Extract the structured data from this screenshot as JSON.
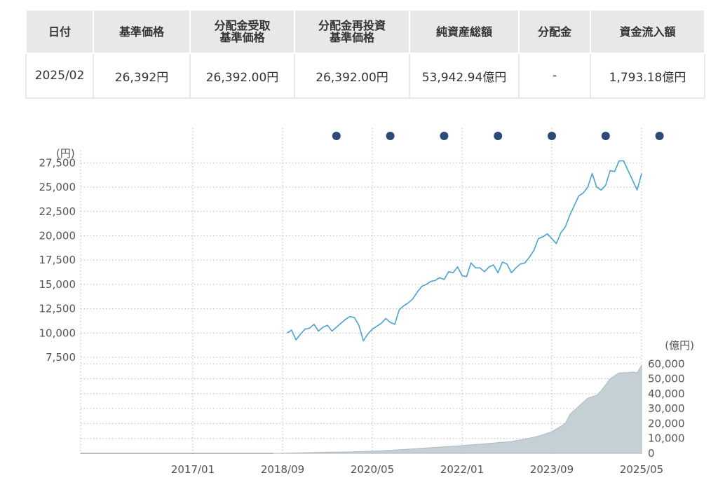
{
  "table": {
    "headers": [
      [
        "日付"
      ],
      [
        "基準価格"
      ],
      [
        "分配金受取",
        "基準価格"
      ],
      [
        "分配金再投資",
        "基準価格"
      ],
      [
        "純資産総額"
      ],
      [
        "分配金"
      ],
      [
        "資金流入額"
      ]
    ],
    "row": [
      "2025/02",
      "26,392円",
      "26,392.00円",
      "26,392.00円",
      "53,942.94億円",
      "-",
      "1,793.18億円"
    ]
  },
  "colors": {
    "price_line": "#4aa3cf",
    "asset_area": "#c5cfd6",
    "marker": "#2b4a76",
    "grid": "#b8b8b8"
  },
  "chart_data": [
    {
      "type": "line",
      "ylabel": "(円)",
      "ylim": [
        7500,
        28750
      ],
      "yticks": [
        "7,500",
        "10,000",
        "12,500",
        "15,000",
        "17,500",
        "20,000",
        "22,500",
        "25,000",
        "27,500"
      ],
      "ytick_values": [
        7500,
        10000,
        12500,
        15000,
        17500,
        20000,
        22500,
        25000,
        27500
      ],
      "xlim": [
        "2014-12",
        "2025-05"
      ],
      "xticks": [
        "2017/01",
        "2018/09",
        "2020/05",
        "2022/01",
        "2023/09",
        "2025/05"
      ],
      "xtick_dates": [
        "2017-01",
        "2018-09",
        "2020-05",
        "2022-01",
        "2023-09",
        "2025-05"
      ],
      "distribution_markers": [
        "2019-09",
        "2020-09",
        "2021-09",
        "2022-09",
        "2023-09",
        "2024-09",
        "2025-09"
      ],
      "series": [
        {
          "x": [
            "2018-10",
            "2018-11",
            "2018-12",
            "2019-01",
            "2019-02",
            "2019-03",
            "2019-04",
            "2019-05",
            "2019-06",
            "2019-07",
            "2019-08",
            "2019-09",
            "2019-10",
            "2019-11",
            "2019-12",
            "2020-01",
            "2020-02",
            "2020-03",
            "2020-04",
            "2020-05",
            "2020-06",
            "2020-07",
            "2020-08",
            "2020-09",
            "2020-10",
            "2020-11",
            "2020-12",
            "2021-01",
            "2021-02",
            "2021-03",
            "2021-04",
            "2021-05",
            "2021-06",
            "2021-07",
            "2021-08",
            "2021-09",
            "2021-10",
            "2021-11",
            "2021-12",
            "2022-01",
            "2022-02",
            "2022-03",
            "2022-04",
            "2022-05",
            "2022-06",
            "2022-07",
            "2022-08",
            "2022-09",
            "2022-10",
            "2022-11",
            "2022-12",
            "2023-01",
            "2023-02",
            "2023-03",
            "2023-04",
            "2023-05",
            "2023-06",
            "2023-07",
            "2023-08",
            "2023-09",
            "2023-10",
            "2023-11",
            "2023-12",
            "2024-01",
            "2024-02",
            "2024-03",
            "2024-04",
            "2024-05",
            "2024-06",
            "2024-07",
            "2024-08",
            "2024-09",
            "2024-10",
            "2024-11",
            "2024-12",
            "2025-01",
            "2025-02",
            "2025-03",
            "2025-04",
            "2025-05"
          ],
          "values": [
            10000,
            10300,
            9300,
            9900,
            10400,
            10500,
            10900,
            10200,
            10600,
            10800,
            10200,
            10600,
            11000,
            11400,
            11700,
            11600,
            10800,
            9200,
            9900,
            10400,
            10700,
            11000,
            11500,
            11100,
            10900,
            12400,
            12800,
            13100,
            13500,
            14200,
            14800,
            15000,
            15300,
            15400,
            15700,
            15500,
            16300,
            16200,
            16800,
            15900,
            15800,
            17200,
            16700,
            16700,
            16300,
            16800,
            17000,
            16200,
            17300,
            17100,
            16200,
            16700,
            17100,
            17200,
            17800,
            18500,
            19700,
            19900,
            20200,
            19700,
            19200,
            20300,
            20900,
            22100,
            23100,
            24100,
            24400,
            25000,
            26400,
            25000,
            24700,
            25200,
            26700,
            26600,
            27700,
            27700,
            26700,
            25700,
            24700,
            26392
          ]
        }
      ]
    },
    {
      "type": "area",
      "ylabel": "(億円)",
      "ylim": [
        0,
        62000
      ],
      "yticks": [
        "0",
        "10,000",
        "20,000",
        "30,000",
        "40,000",
        "50,000",
        "60,000"
      ],
      "ytick_values": [
        0,
        10000,
        20000,
        30000,
        40000,
        50000,
        60000
      ],
      "series": [
        {
          "x": [
            "2018-07",
            "2018-12",
            "2019-06",
            "2019-12",
            "2020-06",
            "2020-12",
            "2021-06",
            "2021-12",
            "2022-06",
            "2022-12",
            "2023-03",
            "2023-06",
            "2023-09",
            "2023-12",
            "2024-01",
            "2024-03",
            "2024-05",
            "2024-06",
            "2024-07",
            "2024-08",
            "2024-10",
            "2024-12",
            "2025-01",
            "2025-02",
            "2025-03",
            "2025-04",
            "2025-05"
          ],
          "values": [
            0,
            300,
            700,
            1000,
            1600,
            2600,
            3800,
            5000,
            6400,
            8000,
            9600,
            11500,
            14500,
            20000,
            26000,
            31500,
            37000,
            38000,
            39000,
            42000,
            50000,
            54000,
            54000,
            54200,
            54500,
            54000,
            59000
          ]
        }
      ]
    }
  ]
}
